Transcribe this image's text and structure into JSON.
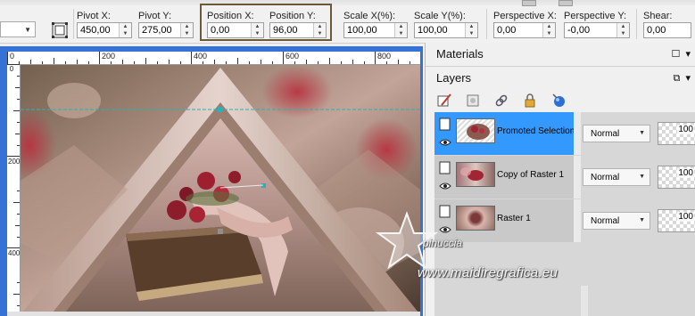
{
  "toolbar": {
    "pivot_x": {
      "label": "Pivot X:",
      "value": "450,00"
    },
    "pivot_y": {
      "label": "Pivot Y:",
      "value": "275,00"
    },
    "position_x": {
      "label": "Position X:",
      "value": "0,00"
    },
    "position_y": {
      "label": "Position Y:",
      "value": "96,00"
    },
    "scale_x": {
      "label": "Scale X(%):",
      "value": "100,00"
    },
    "scale_y": {
      "label": "Scale Y(%):",
      "value": "100,00"
    },
    "perspective_x": {
      "label": "Perspective X:",
      "value": "0,00"
    },
    "perspective_y": {
      "label": "Perspective Y:",
      "value": "-0,00"
    },
    "shear": {
      "label": "Shear:",
      "value": "0,00"
    }
  },
  "ruler": {
    "h_labels": [
      "0",
      "200",
      "400",
      "600",
      "800"
    ],
    "v_labels": [
      "0",
      "200",
      "400"
    ]
  },
  "panels": {
    "materials_title": "Materials",
    "layers_title": "Layers"
  },
  "layers": [
    {
      "name": "Promoted Selection",
      "blend": "Normal",
      "opacity": "100",
      "selected": true
    },
    {
      "name": "Copy of Raster 1",
      "blend": "Normal",
      "opacity": "100",
      "selected": false
    },
    {
      "name": "Raster 1",
      "blend": "Normal",
      "opacity": "100",
      "selected": false
    }
  ],
  "watermark": {
    "brand": "pinuccia",
    "site": "www.maidiregrafica.eu"
  },
  "colors": {
    "canvas_frame": "#3672d6",
    "selected_layer": "#3399ff",
    "highlight_box": "#6b5a3a"
  },
  "icons": {
    "mode": "transform-mode-icon",
    "layer_tools": [
      "new-layer-brush-icon",
      "new-mask-icon",
      "link-icon",
      "lock-icon",
      "layer-styles-icon"
    ]
  }
}
